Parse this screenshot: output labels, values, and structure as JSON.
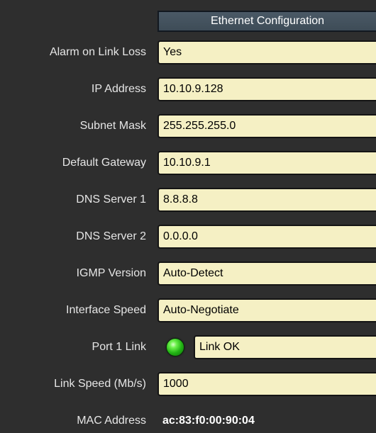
{
  "header": {
    "title": "Ethernet Configuration"
  },
  "rows": [
    {
      "label": "Alarm on Link Loss",
      "value": "Yes"
    },
    {
      "label": "IP Address",
      "value": "10.10.9.128"
    },
    {
      "label": "Subnet Mask",
      "value": "255.255.255.0"
    },
    {
      "label": "Default Gateway",
      "value": "10.10.9.1"
    },
    {
      "label": "DNS Server 1",
      "value": "8.8.8.8"
    },
    {
      "label": "DNS Server 2",
      "value": "0.0.0.0"
    },
    {
      "label": "IGMP Version",
      "value": "Auto-Detect"
    },
    {
      "label": "Interface Speed",
      "value": "Auto-Negotiate"
    }
  ],
  "port_link": {
    "label": "Port 1 Link",
    "status": "Link OK",
    "indicator_color": "#22b414",
    "indicator_icon": "status-led-icon"
  },
  "link_speed": {
    "label": "Link Speed (Mb/s)",
    "value": "1000"
  },
  "mac": {
    "label": "MAC Address",
    "value": "ac:83:f0:00:90:04"
  },
  "colors": {
    "background": "#2e2e2e",
    "field_background": "#f5f0c4",
    "header_background": "#4a5966",
    "label_text": "#e6e6e6"
  }
}
